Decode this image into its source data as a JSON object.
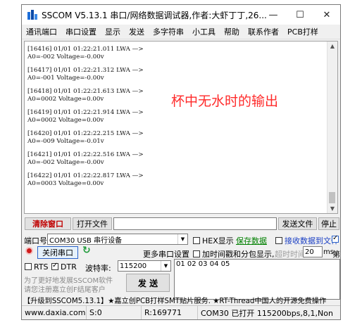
{
  "window": {
    "title": "SSCOM V5.13.1 串口/网络数据调试器,作者:大虾丁丁,26...",
    "minimize": "—",
    "maximize": "☐",
    "close": "✕"
  },
  "menu": [
    "通讯端口",
    "串口设置",
    "显示",
    "发送",
    "多字符串",
    "小工具",
    "帮助",
    "联系作者",
    "PCB打样"
  ],
  "receive_log": [
    {
      "line1": "[16416] 01/01 01:22:21.011 LWA —>",
      "line2": "A0=-002 Voltage=-0.00v"
    },
    {
      "line1": "[16417] 01/01 01:22:21.312 LWA —>",
      "line2": "A0=-001 Voltage=-0.00v"
    },
    {
      "line1": "[16418] 01/01 01:22:21.613 LWA —>",
      "line2": "A0=0002 Voltage=0.00v"
    },
    {
      "line1": "[16419] 01/01 01:22:21.914 LWA —>",
      "line2": "A0=0002 Voltage=0.00v"
    },
    {
      "line1": "[16420] 01/01 01:22:22.215 LWA —>",
      "line2": "A0=-009 Voltage=-0.01v"
    },
    {
      "line1": "[16421] 01/01 01:22:22.516 LWA —>",
      "line2": "A0=-002 Voltage=-0.00v"
    },
    {
      "line1": "[16422] 01/01 01:22:22.817 LWA —>",
      "line2": "A0=0003 Voltage=0.00v"
    }
  ],
  "annotation": "杯中无水时的输出",
  "toolbar": {
    "clear_window": "清除窗口",
    "open_file": "打开文件",
    "send_file": "发送文件",
    "stop": "停止"
  },
  "port": {
    "label": "端口号",
    "value": "COM30 USB 串行设备",
    "hex_display": "HEX显示",
    "save_data": "保存数据",
    "receive_to_file": "接收数据到文件",
    "close_port": "关闭串口",
    "more_settings": "更多串口设置",
    "add_timestamp": "加时间戳和分包显示,",
    "timeout_label": "超时时间:",
    "timeout_value": "20",
    "timeout_unit": "ms",
    "byte_label": "第",
    "rts": "RTS",
    "dtr": "DTR",
    "baud_label": "波特率:",
    "baud_value": "115200"
  },
  "send": {
    "input_value": "01 02 03 04 05",
    "promo_line1": "为了更好地发展SSCOM软件",
    "promo_line2": "请您注册嘉立创F结尾客户",
    "send_button": "发 送"
  },
  "ticker": "【升级到SSCOM5.13.1】★嘉立创PCB打样SMT贴片服务. ★RT-Thread中国人的开源免费操作",
  "status": {
    "website": "www.daxia.com",
    "sent": "S:0",
    "received": "R:169771",
    "port_state": "COM30 已打开  115200bps,8,1,Non"
  },
  "colors": {
    "annotation": "#ff2a2a",
    "clear_button_text": "#c00000",
    "link_green": "#008000",
    "receive_to_file_text": "#1a3fc4",
    "close_port_border": "#2a62c9",
    "refresh_icon": "#1f9b3a",
    "record_icon": "#d11a1a"
  }
}
